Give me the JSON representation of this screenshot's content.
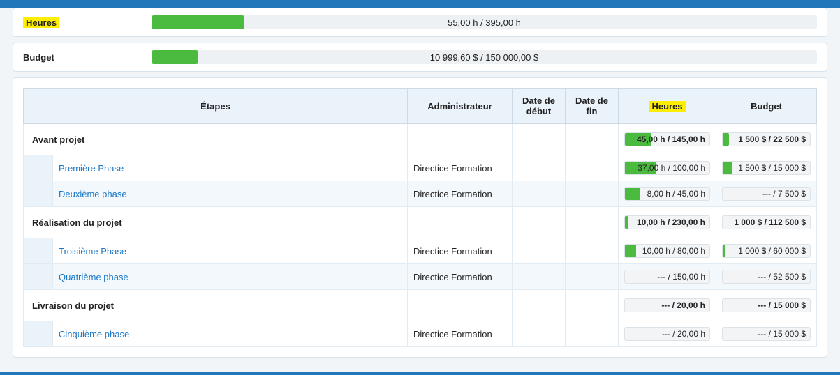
{
  "summary": {
    "heures": {
      "label": "Heures",
      "text": "55,00 h / 395,00 h",
      "pct": 14
    },
    "budget": {
      "label": "Budget",
      "text": "10 999,60 $ / 150 000,00 $",
      "pct": 7
    }
  },
  "columns": {
    "etapes": "Étapes",
    "admin": "Administrateur",
    "date_debut": "Date de début",
    "date_fin": "Date de fin",
    "heures": "Heures",
    "budget": "Budget"
  },
  "groups": [
    {
      "name": "Avant projet",
      "heures": {
        "text": "45,00 h / 145,00 h",
        "pct": 31
      },
      "budget": {
        "text": "1 500 $ / 22 500 $",
        "pct": 7
      },
      "rows": [
        {
          "name": "Première Phase",
          "admin": "Directice Formation",
          "date_debut": "",
          "date_fin": "",
          "heures": {
            "text": "37,00 h / 100,00 h",
            "pct": 37
          },
          "budget": {
            "text": "1 500 $ / 15 000 $",
            "pct": 10
          }
        },
        {
          "name": "Deuxième phase",
          "admin": "Directice Formation",
          "date_debut": "",
          "date_fin": "",
          "heures": {
            "text": "8,00 h / 45,00 h",
            "pct": 18
          },
          "budget": {
            "text": "--- / 7 500 $",
            "pct": 0
          }
        }
      ]
    },
    {
      "name": "Réalisation du projet",
      "heures": {
        "text": "10,00 h / 230,00 h",
        "pct": 4
      },
      "budget": {
        "text": "1 000 $ / 112 500 $",
        "pct": 1
      },
      "rows": [
        {
          "name": "Troisième Phase",
          "admin": "Directice Formation",
          "date_debut": "",
          "date_fin": "",
          "heures": {
            "text": "10,00 h / 80,00 h",
            "pct": 13
          },
          "budget": {
            "text": "1 000 $ / 60 000 $",
            "pct": 2
          }
        },
        {
          "name": "Quatrième phase",
          "admin": "Directice Formation",
          "date_debut": "",
          "date_fin": "",
          "heures": {
            "text": "--- / 150,00 h",
            "pct": 0
          },
          "budget": {
            "text": "--- / 52 500 $",
            "pct": 0
          }
        }
      ]
    },
    {
      "name": "Livraison du projet",
      "heures": {
        "text": "--- / 20,00 h",
        "pct": 0
      },
      "budget": {
        "text": "--- / 15 000 $",
        "pct": 0
      },
      "rows": [
        {
          "name": "Cinquième phase",
          "admin": "Directice Formation",
          "date_debut": "",
          "date_fin": "",
          "heures": {
            "text": "--- / 20,00 h",
            "pct": 0
          },
          "budget": {
            "text": "--- / 15 000 $",
            "pct": 0
          }
        }
      ]
    }
  ]
}
